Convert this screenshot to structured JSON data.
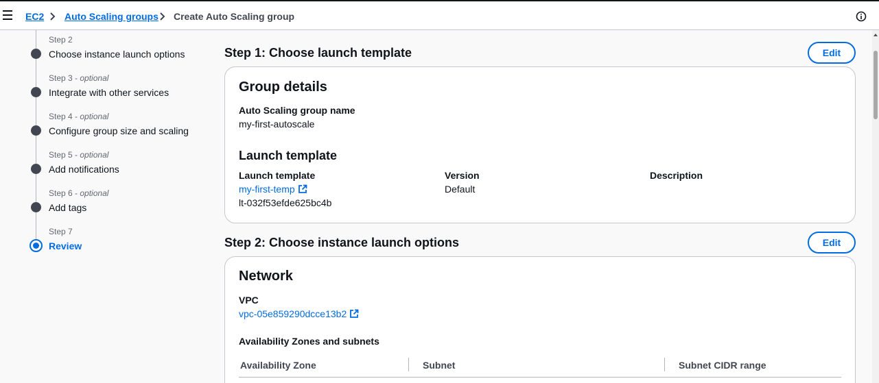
{
  "breadcrumb": {
    "items": [
      "EC2",
      "Auto Scaling groups"
    ],
    "current": "Create Auto Scaling group"
  },
  "steps": [
    {
      "num": "Step 2",
      "optional": "",
      "title": "Choose instance launch options"
    },
    {
      "num": "Step 3",
      "optional": "optional",
      "title": "Integrate with other services"
    },
    {
      "num": "Step 4",
      "optional": "optional",
      "title": "Configure group size and scaling"
    },
    {
      "num": "Step 5",
      "optional": "optional",
      "title": "Add notifications"
    },
    {
      "num": "Step 6",
      "optional": "optional",
      "title": "Add tags"
    },
    {
      "num": "Step 7",
      "optional": "",
      "title": "Review"
    }
  ],
  "step1": {
    "title": "Step 1: Choose launch template",
    "edit_label": "Edit",
    "group_details_heading": "Group details",
    "asg_name_label": "Auto Scaling group name",
    "asg_name_value": "my-first-autoscale",
    "launch_template_heading": "Launch template",
    "lt_label": "Launch template",
    "lt_link": "my-first-temp",
    "lt_id": "lt-032f53efde625bc4b",
    "version_label": "Version",
    "version_value": "Default",
    "description_label": "Description"
  },
  "step2": {
    "title": "Step 2: Choose instance launch options",
    "edit_label": "Edit",
    "network_heading": "Network",
    "vpc_label": "VPC",
    "vpc_link": "vpc-05e859290dcce13b2",
    "az_subnets_label": "Availability Zones and subnets",
    "table_headers": [
      "Availability Zone",
      "Subnet",
      "Subnet CIDR range"
    ]
  },
  "colors": {
    "accent": "#006ce0",
    "text": "#0f141a",
    "muted": "#656871"
  },
  "icons": [
    "menu-icon",
    "chevron-right-icon",
    "info-icon",
    "external-link-icon"
  ]
}
